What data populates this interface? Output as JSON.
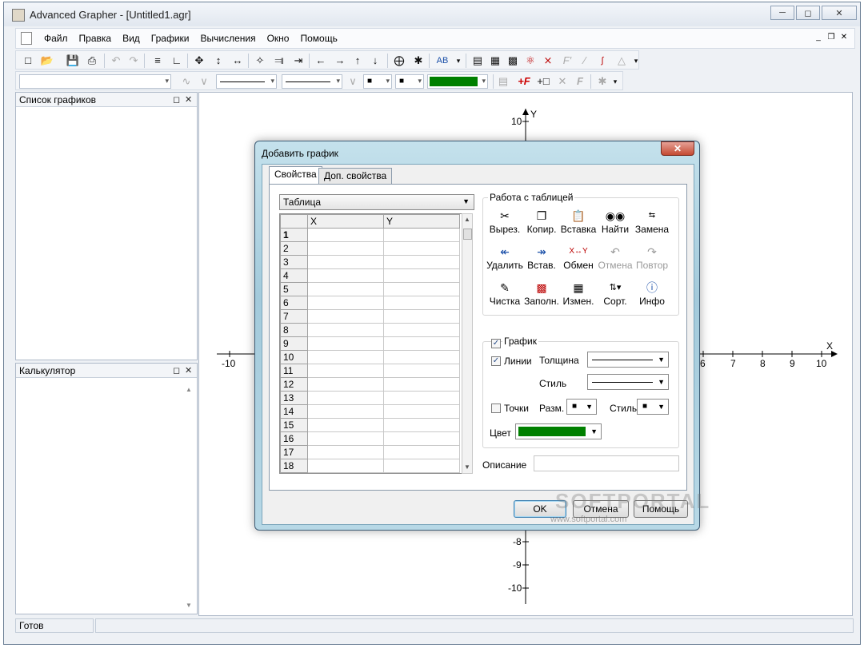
{
  "window": {
    "title": "Advanced Grapher - [Untitled1.agr]"
  },
  "menu": [
    "Файл",
    "Правка",
    "Вид",
    "Графики",
    "Вычисления",
    "Окно",
    "Помощь"
  ],
  "toolbar2": {
    "style_label": "AB"
  },
  "panels": {
    "graph_list": {
      "title": "Список графиков"
    },
    "calculator": {
      "title": "Калькулятор"
    }
  },
  "axes": {
    "x_label": "X",
    "y_label": "Y",
    "x_ticks": [
      "-10",
      "7",
      "8",
      "9",
      "10"
    ],
    "x_tick_6": "6",
    "y_ticks": [
      "10",
      "-8",
      "-9",
      "-10"
    ]
  },
  "status": {
    "text": "Готов"
  },
  "dialog": {
    "title": "Добавить график",
    "tabs": [
      "Свойства",
      "Доп. свойства"
    ],
    "type_select": "Таблица",
    "table": {
      "headers": [
        "X",
        "Y"
      ],
      "rows": [
        "1",
        "2",
        "3",
        "4",
        "5",
        "6",
        "7",
        "8",
        "9",
        "10",
        "11",
        "12",
        "13",
        "14",
        "15",
        "16",
        "17",
        "18"
      ]
    },
    "table_tools": {
      "title": "Работа с таблицей",
      "row1": [
        "Вырез.",
        "Копир.",
        "Вставка",
        "Найти",
        "Замена"
      ],
      "row2": [
        "Удалить",
        "Встав.",
        "Обмен",
        "Отмена",
        "Повтор"
      ],
      "row3": [
        "Чистка",
        "Заполн.",
        "Измен.",
        "Сорт.",
        "Инфо"
      ]
    },
    "graph_props": {
      "graph_label": "График",
      "lines_label": "Линии",
      "thickness_label": "Толщина",
      "style_label": "Стиль",
      "points_label": "Точки",
      "size_label": "Разм.",
      "point_style_label": "Стиль",
      "color_label": "Цвет",
      "color": "#008000"
    },
    "description_label": "Описание",
    "buttons": {
      "ok": "OK",
      "cancel": "Отмена",
      "help": "Помощь"
    }
  },
  "watermark": {
    "main": "SOFTPORTAL",
    "sub": "www.softportal.com"
  }
}
